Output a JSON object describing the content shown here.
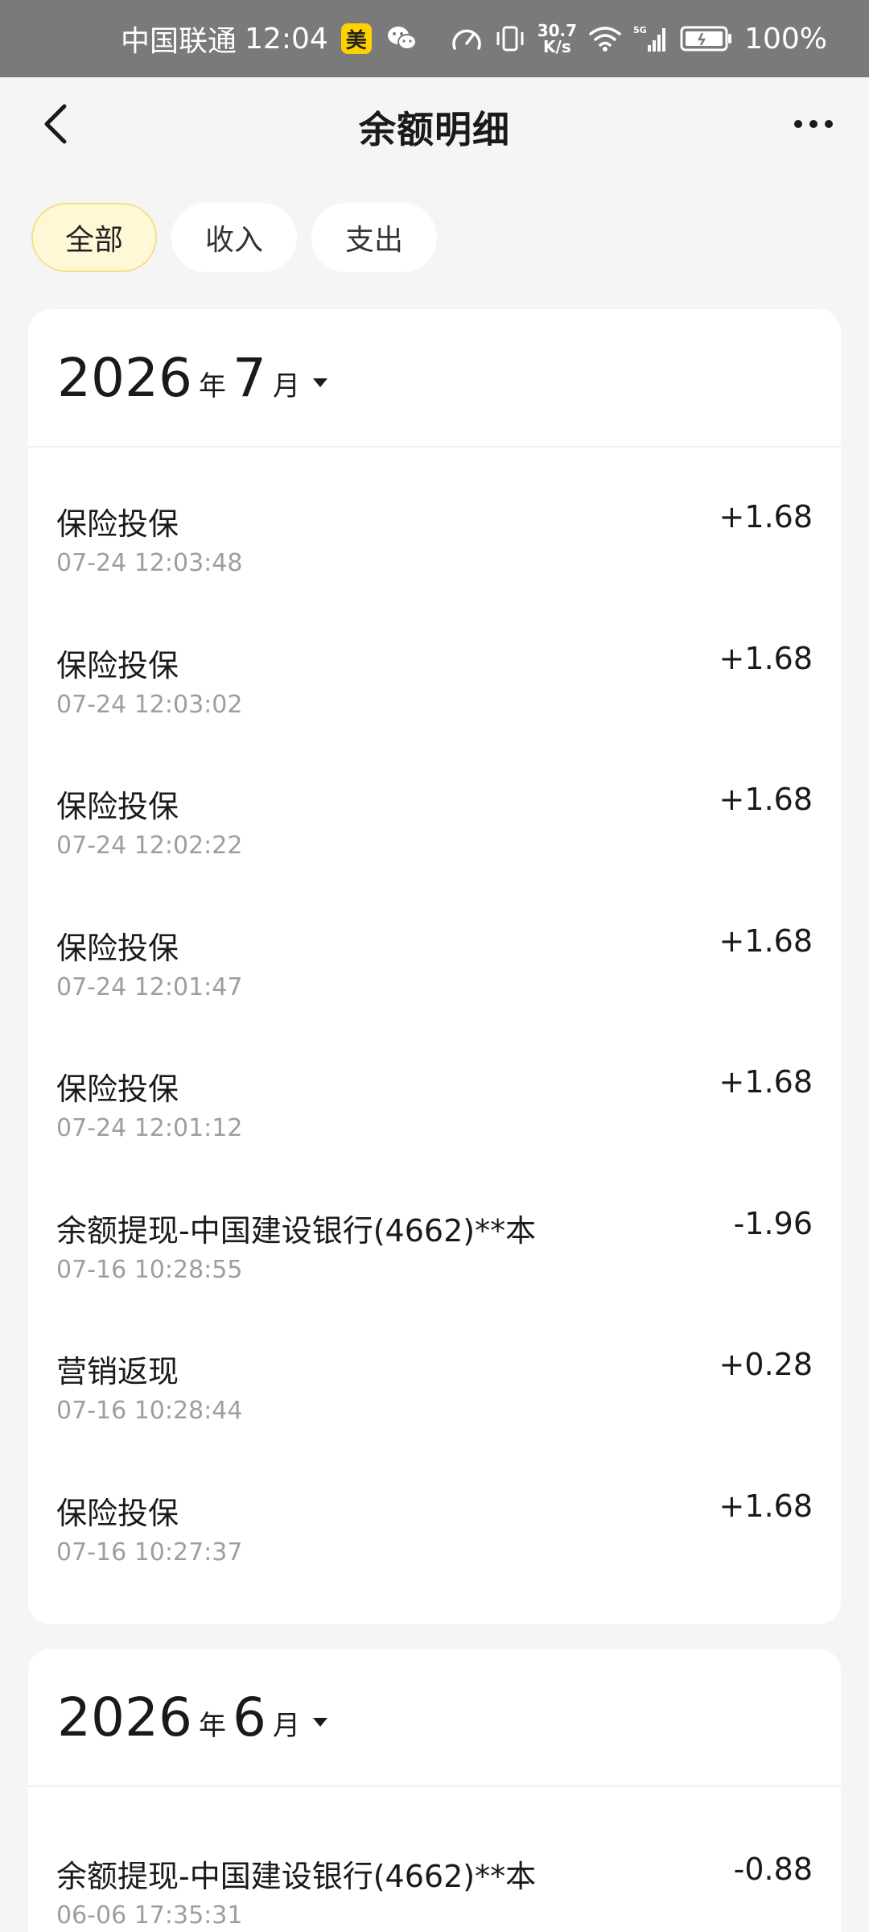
{
  "status_bar": {
    "carrier": "中国联通",
    "time": "12:04",
    "app_badge": "美",
    "net_speed_value": "30.7",
    "net_speed_unit": "K/s",
    "network": "5G",
    "battery": "100%"
  },
  "header": {
    "title": "余额明细"
  },
  "filters": [
    {
      "label": "全部",
      "active": true
    },
    {
      "label": "收入",
      "active": false
    },
    {
      "label": "支出",
      "active": false
    }
  ],
  "months": [
    {
      "year": "2026",
      "year_unit": "年",
      "month": "7",
      "month_unit": "月",
      "items": [
        {
          "name": "保险投保",
          "time": "07-24 12:03:48",
          "amount": "+1.68"
        },
        {
          "name": "保险投保",
          "time": "07-24 12:03:02",
          "amount": "+1.68"
        },
        {
          "name": "保险投保",
          "time": "07-24 12:02:22",
          "amount": "+1.68"
        },
        {
          "name": "保险投保",
          "time": "07-24 12:01:47",
          "amount": "+1.68"
        },
        {
          "name": "保险投保",
          "time": "07-24 12:01:12",
          "amount": "+1.68"
        },
        {
          "name": "余额提现-中国建设银行(4662)**本",
          "time": "07-16 10:28:55",
          "amount": "-1.96"
        },
        {
          "name": "营销返现",
          "time": "07-16 10:28:44",
          "amount": "+0.28"
        },
        {
          "name": "保险投保",
          "time": "07-16 10:27:37",
          "amount": "+1.68"
        }
      ]
    },
    {
      "year": "2026",
      "year_unit": "年",
      "month": "6",
      "month_unit": "月",
      "items": [
        {
          "name": "余额提现-中国建设银行(4662)**本",
          "time": "06-06 17:35:31",
          "amount": "-0.88"
        }
      ]
    }
  ]
}
